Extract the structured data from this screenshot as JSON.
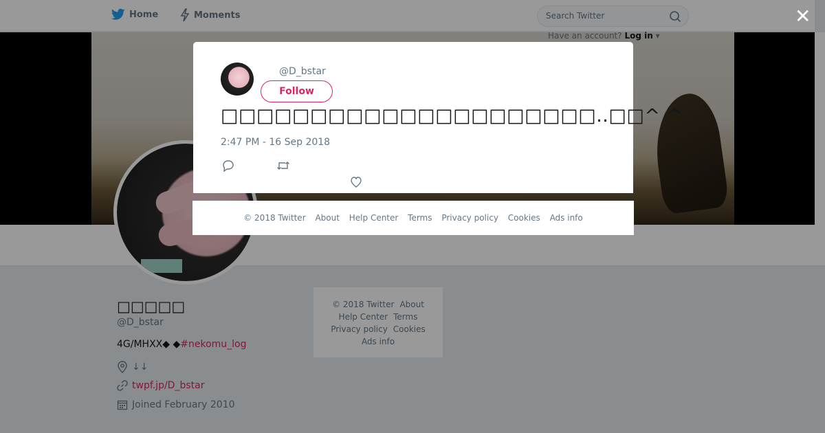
{
  "nav": {
    "home": "Home",
    "moments": "Moments",
    "search_placeholder": "Search Twitter",
    "have_account": "Have an account?",
    "login": "Log in"
  },
  "profile": {
    "name": "□□□□□",
    "handle": "@D_bstar",
    "bio_text": "4G/MHXX◆ ◆",
    "bio_hashtag": "#nekomu_log",
    "location": "↓↓",
    "url": "twpf.jp/D_bstar",
    "joined": "Joined February 2010"
  },
  "sidebar_footer": {
    "copyright": "© 2018 Twitter",
    "about": "About",
    "help": "Help Center",
    "terms": "Terms",
    "privacy": "Privacy policy",
    "cookies": "Cookies",
    "ads": "Ads info"
  },
  "modal": {
    "handle": "@D_bstar",
    "follow_label": "Follow",
    "tweet_text": "□□□□□□□□□□□□□□□□□□□□□..□□^ ^",
    "timestamp": "2:47 PM - 16 Sep 2018",
    "close_glyph": "✕"
  },
  "modal_footer": {
    "copyright": "© 2018 Twitter",
    "about": "About",
    "help": "Help Center",
    "terms": "Terms",
    "privacy": "Privacy policy",
    "cookies": "Cookies",
    "ads": "Ads info"
  },
  "icons": {
    "bird": "twitter-bird-icon",
    "moments": "lightning-icon",
    "search": "search-icon",
    "location": "location-pin-icon",
    "link": "link-icon",
    "calendar": "calendar-icon",
    "reply": "reply-icon",
    "retweet": "retweet-icon",
    "like": "heart-icon",
    "close": "close-icon"
  },
  "colors": {
    "brand": "#1da1f2",
    "accent": "#e0245e",
    "muted": "#657786"
  }
}
